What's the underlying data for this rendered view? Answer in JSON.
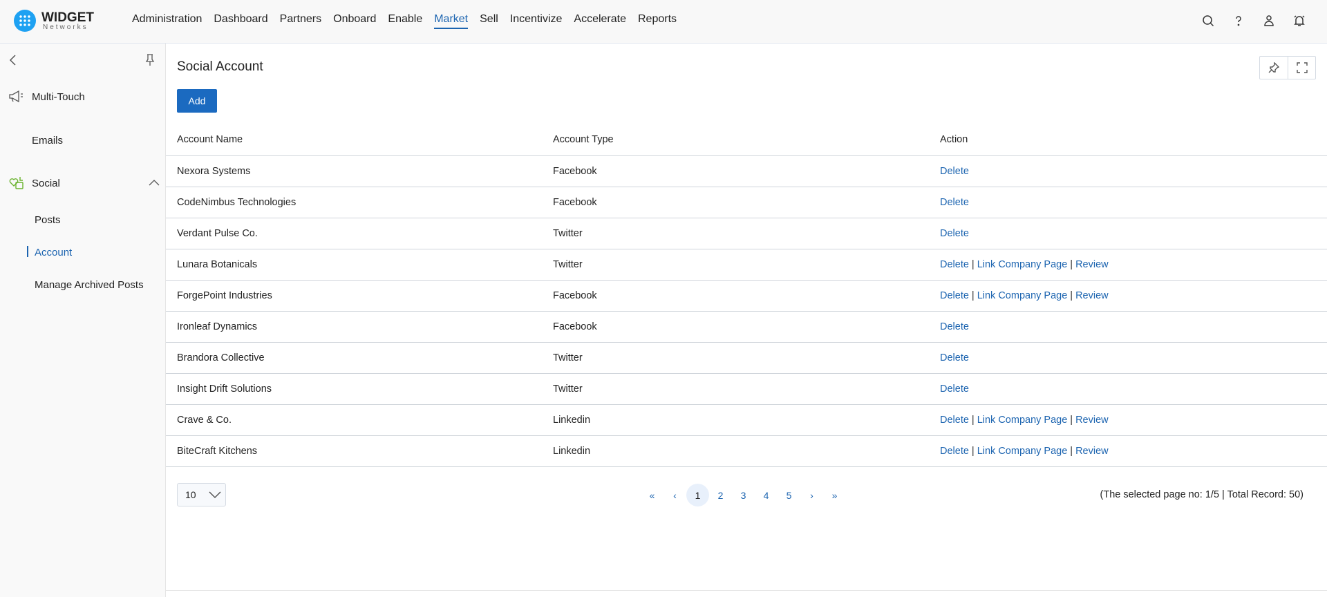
{
  "brand": {
    "name": "WIDGET",
    "sub": "Networks"
  },
  "nav": [
    "Administration",
    "Dashboard",
    "Partners",
    "Onboard",
    "Enable",
    "Market",
    "Sell",
    "Incentivize",
    "Accelerate",
    "Reports"
  ],
  "nav_active": "Market",
  "sidebar": {
    "multi_touch": "Multi-Touch",
    "emails": "Emails",
    "social": "Social",
    "posts": "Posts",
    "account": "Account",
    "archived": "Manage Archived Posts"
  },
  "page": {
    "title": "Social Account",
    "add": "Add"
  },
  "table": {
    "headers": [
      "Account Name",
      "Account Type",
      "Action"
    ],
    "rows": [
      {
        "name": "Nexora Systems",
        "type": "Facebook",
        "actions": [
          "Delete"
        ]
      },
      {
        "name": "CodeNimbus Technologies",
        "type": "Facebook",
        "actions": [
          "Delete"
        ]
      },
      {
        "name": "Verdant Pulse Co.",
        "type": "Twitter",
        "actions": [
          "Delete"
        ]
      },
      {
        "name": "Lunara Botanicals",
        "type": "Twitter",
        "actions": [
          "Delete",
          "Link Company Page",
          "Review"
        ]
      },
      {
        "name": "ForgePoint Industries",
        "type": "Facebook",
        "actions": [
          "Delete",
          "Link Company Page",
          "Review"
        ]
      },
      {
        "name": "Ironleaf Dynamics",
        "type": "Facebook",
        "actions": [
          "Delete"
        ]
      },
      {
        "name": "Brandora Collective",
        "type": "Twitter",
        "actions": [
          "Delete"
        ]
      },
      {
        "name": "Insight Drift Solutions",
        "type": "Twitter",
        "actions": [
          "Delete"
        ]
      },
      {
        "name": "Crave & Co.",
        "type": "Linkedin",
        "actions": [
          "Delete",
          "Link Company Page",
          "Review"
        ]
      },
      {
        "name": "BiteCraft Kitchens",
        "type": "Linkedin",
        "actions": [
          "Delete",
          "Link Company Page",
          "Review"
        ]
      }
    ]
  },
  "pagination": {
    "page_size": "10",
    "pages": [
      "1",
      "2",
      "3",
      "4",
      "5"
    ],
    "current": "1",
    "first": "«",
    "prev": "‹",
    "next": "›",
    "last": "»",
    "info": "(The selected page no: 1/5 | Total Record: 50)"
  }
}
